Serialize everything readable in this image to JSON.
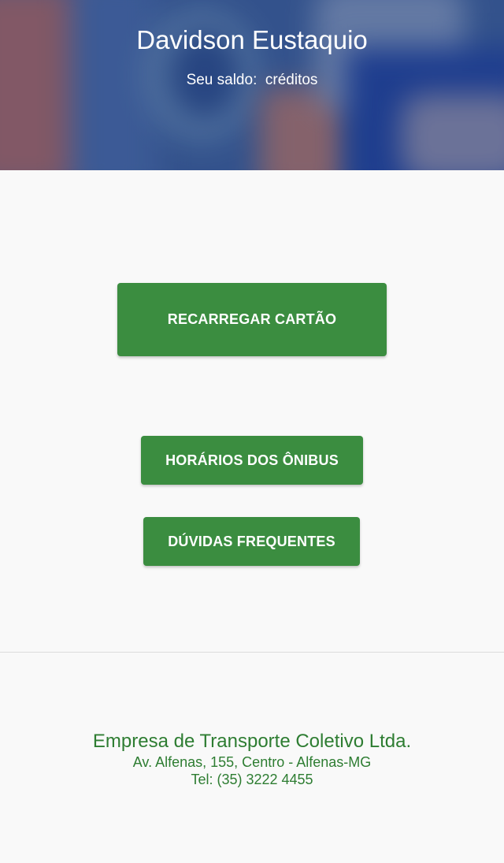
{
  "header": {
    "user_name": "Davidson Eustaquio",
    "balance_text": "Seu saldo:  créditos"
  },
  "actions": {
    "recharge_label": "RECARREGAR CARTÃO",
    "schedule_label": "HORÁRIOS DOS ÔNIBUS",
    "faq_label": "DÚVIDAS FREQUENTES"
  },
  "footer": {
    "company_name": "Empresa de Transporte Coletivo Ltda.",
    "address": "Av. Alfenas, 155, Centro - Alfenas-MG",
    "phone": "Tel: (35) 3222 4455"
  },
  "colors": {
    "primary_button": "#3b8d40",
    "footer_text": "#2e7d32",
    "header_overlay": "#3d5f97",
    "background": "#f9f9f9"
  }
}
